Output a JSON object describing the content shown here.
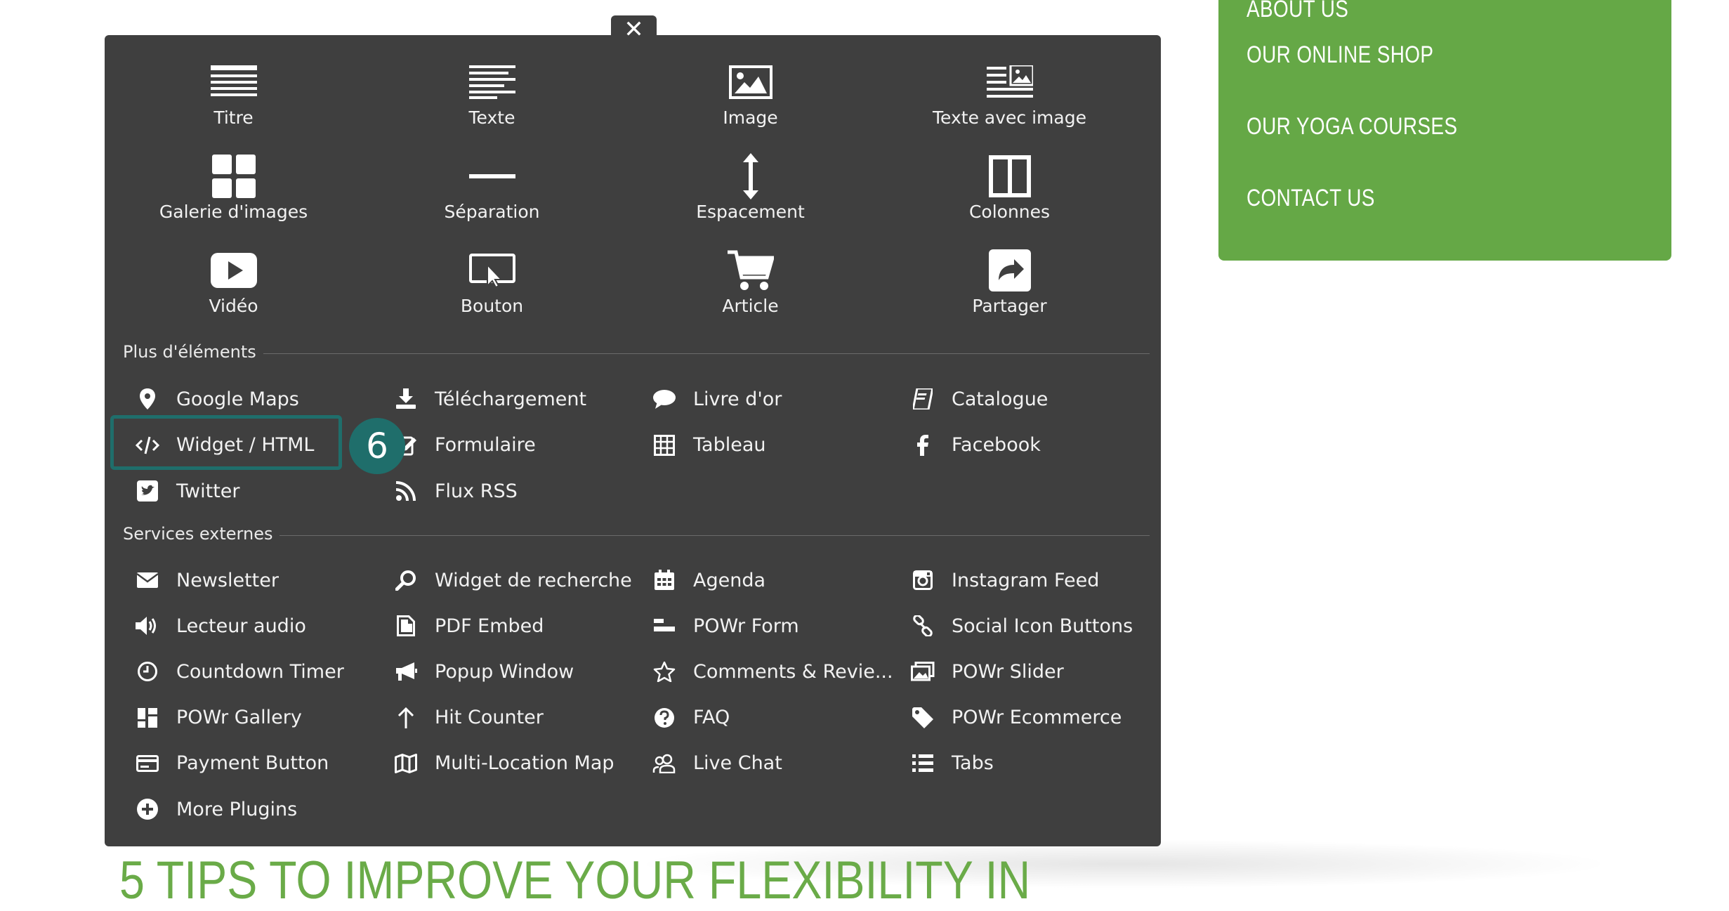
{
  "nav": {
    "items": [
      "ABOUT US",
      "OUR ONLINE SHOP",
      "OUR YOGA COURSES",
      "CONTACT US"
    ],
    "color": "#65a846"
  },
  "headline": "5 TIPS TO IMPROVE YOUR FLEXIBILITY IN",
  "panel": {
    "close_label": "✕",
    "basic": [
      {
        "label": "Titre",
        "icon": "title-icon"
      },
      {
        "label": "Texte",
        "icon": "text-icon"
      },
      {
        "label": "Image",
        "icon": "image-icon"
      },
      {
        "label": "Texte avec image",
        "icon": "text-with-image-icon"
      },
      {
        "label": "Galerie d'images",
        "icon": "gallery-icon"
      },
      {
        "label": "Séparation",
        "icon": "separator-icon"
      },
      {
        "label": "Espacement",
        "icon": "spacing-icon"
      },
      {
        "label": "Colonnes",
        "icon": "columns-icon"
      },
      {
        "label": "Vidéo",
        "icon": "video-icon"
      },
      {
        "label": "Bouton",
        "icon": "button-icon"
      },
      {
        "label": "Article",
        "icon": "cart-icon"
      },
      {
        "label": "Partager",
        "icon": "share-icon"
      }
    ],
    "more_title": "Plus d'éléments",
    "more": [
      {
        "label": "Google Maps",
        "icon": "map-pin-icon"
      },
      {
        "label": "Téléchargement",
        "icon": "download-icon"
      },
      {
        "label": "Livre d'or",
        "icon": "speech-bubble-icon"
      },
      {
        "label": "Catalogue",
        "icon": "catalog-icon"
      },
      {
        "label": "Widget / HTML",
        "icon": "code-icon"
      },
      {
        "label": "Formulaire",
        "icon": "form-icon"
      },
      {
        "label": "Tableau",
        "icon": "table-icon"
      },
      {
        "label": "Facebook",
        "icon": "facebook-icon"
      },
      {
        "label": "Twitter",
        "icon": "twitter-icon"
      },
      {
        "label": "Flux RSS",
        "icon": "rss-icon"
      }
    ],
    "ext_title": "Services externes",
    "external": [
      {
        "label": "Newsletter",
        "icon": "envelope-icon"
      },
      {
        "label": "Widget de recherche",
        "icon": "search-icon"
      },
      {
        "label": "Agenda",
        "icon": "calendar-icon"
      },
      {
        "label": "Instagram Feed",
        "icon": "instagram-icon"
      },
      {
        "label": "Lecteur audio",
        "icon": "speaker-icon"
      },
      {
        "label": "PDF Embed",
        "icon": "pdf-icon"
      },
      {
        "label": "POWr Form",
        "icon": "form-bars-icon"
      },
      {
        "label": "Social Icon Buttons",
        "icon": "link-icon"
      },
      {
        "label": "Countdown Timer",
        "icon": "clock-icon"
      },
      {
        "label": "Popup Window",
        "icon": "megaphone-icon"
      },
      {
        "label": "Comments & Revie...",
        "icon": "star-icon"
      },
      {
        "label": "POWr Slider",
        "icon": "slider-icon"
      },
      {
        "label": "POWr Gallery",
        "icon": "dashboard-icon"
      },
      {
        "label": "Hit Counter",
        "icon": "arrow-up-icon"
      },
      {
        "label": "FAQ",
        "icon": "question-icon"
      },
      {
        "label": "POWr Ecommerce",
        "icon": "tag-icon"
      },
      {
        "label": "Payment Button",
        "icon": "credit-card-icon"
      },
      {
        "label": "Multi-Location Map",
        "icon": "folded-map-icon"
      },
      {
        "label": "Live Chat",
        "icon": "users-icon"
      },
      {
        "label": "Tabs",
        "icon": "list-icon"
      },
      {
        "label": "More Plugins",
        "icon": "plus-circle-icon"
      }
    ]
  },
  "step_badge": "6"
}
